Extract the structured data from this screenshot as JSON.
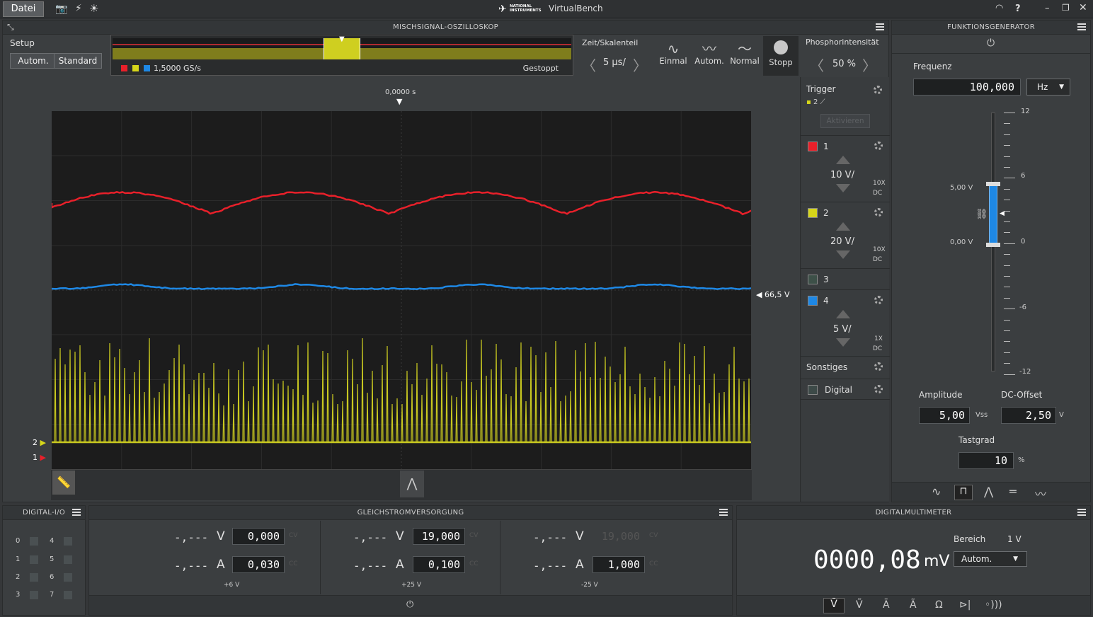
{
  "app": {
    "file_tab": "Datei",
    "brand": "NATIONAL INSTRUMENTS",
    "title": "VirtualBench"
  },
  "osc": {
    "header": "MISCHSIGNAL-OSZILLOSKOP",
    "setup_label": "Setup",
    "auto_button": "Autom.",
    "standard_button": "Standard",
    "sample_rate": "1,5000 GS/s",
    "status": "Gestoppt",
    "timebase_label": "Zeit/Skalenteil",
    "timebase_value": "5 µs/",
    "mode_single": "Einmal",
    "mode_auto": "Autom.",
    "mode_normal": "Normal",
    "mode_stop": "Stopp",
    "phosphor_label": "Phosphorintensität",
    "phosphor_value": "50 %",
    "time_marker": "0,0000 s",
    "trigger_level": "66,5 V",
    "ch_marker_2": "2",
    "ch_marker_1": "1"
  },
  "trigger": {
    "label": "Trigger",
    "source": "2",
    "arm_button": "Aktivieren"
  },
  "channels": [
    {
      "num": "1",
      "scale": "10 V/",
      "probe": "10X",
      "coupling": "DC",
      "color": "#e8202a"
    },
    {
      "num": "2",
      "scale": "20 V/",
      "probe": "10X",
      "coupling": "DC",
      "color": "#d6d61a"
    },
    {
      "num": "3",
      "color": "#3d5048"
    },
    {
      "num": "4",
      "scale": "5 V/",
      "probe": "1X",
      "coupling": "DC",
      "color": "#1e88e5"
    }
  ],
  "other": {
    "label": "Sonstiges",
    "digital": "Digital"
  },
  "fgen": {
    "header": "FUNKTIONSGENERATOR",
    "freq_label": "Frequenz",
    "freq_value": "100,000",
    "freq_unit": "Hz",
    "scale_ticks": [
      "12",
      "6",
      "0",
      "-6",
      "-12"
    ],
    "high_level": "5,00 V",
    "low_level": "0,00 V",
    "amplitude_label": "Amplitude",
    "amplitude_value": "5,00",
    "amplitude_unit": "Vss",
    "offset_label": "DC-Offset",
    "offset_value": "2,50",
    "offset_unit": "V",
    "duty_label": "Tastgrad",
    "duty_value": "10",
    "duty_unit": "%"
  },
  "dio": {
    "header": "DIGITAL-I/O",
    "pins_left": [
      "0",
      "1",
      "2",
      "3"
    ],
    "pins_right": [
      "4",
      "5",
      "6",
      "7"
    ]
  },
  "psu": {
    "header": "GLEICHSTROMVERSORGUNG",
    "channels": [
      {
        "v_read": "-,---",
        "v_unit": "V",
        "v_set": "0,000",
        "v_tag": "CV",
        "a_read": "-,---",
        "a_unit": "A",
        "a_set": "0,030",
        "a_tag": "CC",
        "label": "+6 V"
      },
      {
        "v_read": "-,---",
        "v_unit": "V",
        "v_set": "19,000",
        "v_tag": "CV",
        "a_read": "-,---",
        "a_unit": "A",
        "a_set": "0,100",
        "a_tag": "CC",
        "label": "+25 V"
      },
      {
        "v_read": "-,---",
        "v_unit": "V",
        "v_set": "19,000",
        "v_tag": "CV",
        "a_read": "-,---",
        "a_unit": "A",
        "a_set": "1,000",
        "a_tag": "CC",
        "label": "-25 V"
      }
    ]
  },
  "dmm": {
    "header": "DIGITALMULTIMETER",
    "range_label": "Bereich",
    "range_value": "1 V",
    "reading": "0000,08",
    "unit": "mV",
    "mode": "Autom."
  }
}
